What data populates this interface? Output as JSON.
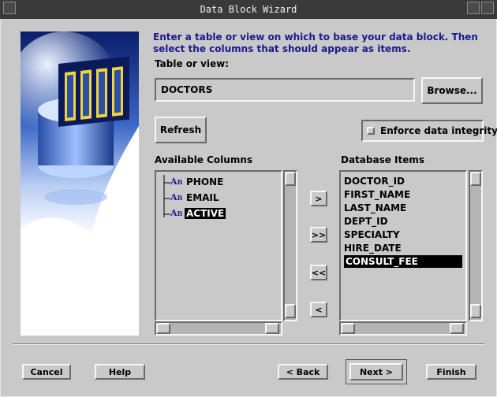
{
  "window": {
    "title": "Data Block Wizard"
  },
  "instructions": "Enter a table or view on which to base your data block. Then select the columns that should appear as items.",
  "table": {
    "label": "Table or view:",
    "value": "DOCTORS",
    "browse_label": "Browse...",
    "refresh_label": "Refresh",
    "enforce_label": "Enforce data integrity",
    "enforce_checked": false
  },
  "available": {
    "label": "Available Columns",
    "items": [
      {
        "label": "PHONE",
        "selected": false
      },
      {
        "label": "EMAIL",
        "selected": false
      },
      {
        "label": "ACTIVE",
        "selected": true
      }
    ]
  },
  "database_items": {
    "label": "Database Items",
    "items": [
      {
        "label": "DOCTOR_ID",
        "selected": false
      },
      {
        "label": "FIRST_NAME",
        "selected": false
      },
      {
        "label": "LAST_NAME",
        "selected": false
      },
      {
        "label": "DEPT_ID",
        "selected": false
      },
      {
        "label": "SPECIALTY",
        "selected": false
      },
      {
        "label": "HIRE_DATE",
        "selected": false
      },
      {
        "label": "CONSULT_FEE",
        "selected": true
      }
    ]
  },
  "move_buttons": {
    "add_one": ">",
    "add_all": ">>",
    "remove_all": "<<",
    "remove_one": "<"
  },
  "footer": {
    "cancel": "Cancel",
    "help": "Help",
    "back": "< Back",
    "next": "Next >",
    "finish": "Finish"
  },
  "colors": {
    "instruction_text": "#1a1a8c",
    "background": "#c9c9c9",
    "selection": "#000000"
  }
}
